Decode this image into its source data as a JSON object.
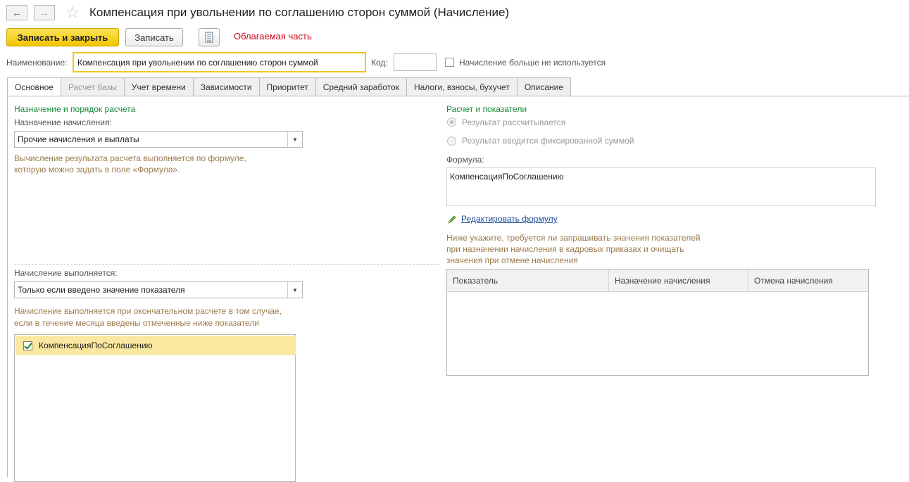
{
  "window": {
    "title": "Компенсация при увольнении по соглашению сторон суммой (Начисление)"
  },
  "toolbar": {
    "save_close_label": "Записать и закрыть",
    "save_label": "Записать",
    "taxable_label": "Облагаемая часть"
  },
  "name_row": {
    "name_label": "Наименование:",
    "name_value": "Компенсация при увольнении по соглашению сторон суммой",
    "code_label": "Код:",
    "code_value": "",
    "not_used_label": "Начисление больше не используется"
  },
  "tabs": [
    {
      "label": "Основное",
      "state": "active"
    },
    {
      "label": "Расчет базы",
      "state": "disabled"
    },
    {
      "label": "Учет времени",
      "state": "normal"
    },
    {
      "label": "Зависимости",
      "state": "normal"
    },
    {
      "label": "Приоритет",
      "state": "normal"
    },
    {
      "label": "Средний заработок",
      "state": "normal"
    },
    {
      "label": "Налоги, взносы, бухучет",
      "state": "normal"
    },
    {
      "label": "Описание",
      "state": "normal"
    }
  ],
  "left": {
    "section_title": "Назначение и порядок расчета",
    "purpose_label": "Назначение начисления:",
    "purpose_value": "Прочие начисления и выплаты",
    "purpose_hint_1": "Вычисление результата расчета выполняется по формуле,",
    "purpose_hint_2": "которую можно задать в поле «Формула».",
    "exec_label": "Начисление выполняется:",
    "exec_value": "Только если введено значение показателя",
    "exec_hint_1": "Начисление выполняется при окончательном расчете в том случае,",
    "exec_hint_2": "если в течение месяца введены отмеченные ниже показатели",
    "indicators": [
      {
        "label": "КомпенсацияПоСоглашению",
        "checked": true
      }
    ]
  },
  "right": {
    "section_title": "Расчет и показатели",
    "radio_calculated": "Результат рассчитывается",
    "radio_fixed": "Результат вводится фиксированной суммой",
    "formula_label": "Формула:",
    "formula_value": "КомпенсацияПоСоглашению",
    "edit_formula_link": "Редактировать формулу",
    "table_hint_1": "Ниже укажите, требуется ли запрашивать значения показателей",
    "table_hint_2": "при назначении начисления в кадровых приказах и очищать",
    "table_hint_3": "значения при отмене начисления",
    "table_columns": [
      "Показатель",
      "Назначение начисления",
      "Отмена начисления"
    ]
  },
  "colors": {
    "primary_button": "#f2c400",
    "section_title": "#1a8a3c",
    "hint_text": "#9b7b4e",
    "red_label": "#d0021b",
    "selected_row": "#fbe8a0"
  },
  "icons": [
    "back-arrow-icon",
    "forward-arrow-icon",
    "star-icon",
    "report-icon",
    "checkmark-icon",
    "pencil-icon",
    "dropdown-arrow-icon"
  ]
}
